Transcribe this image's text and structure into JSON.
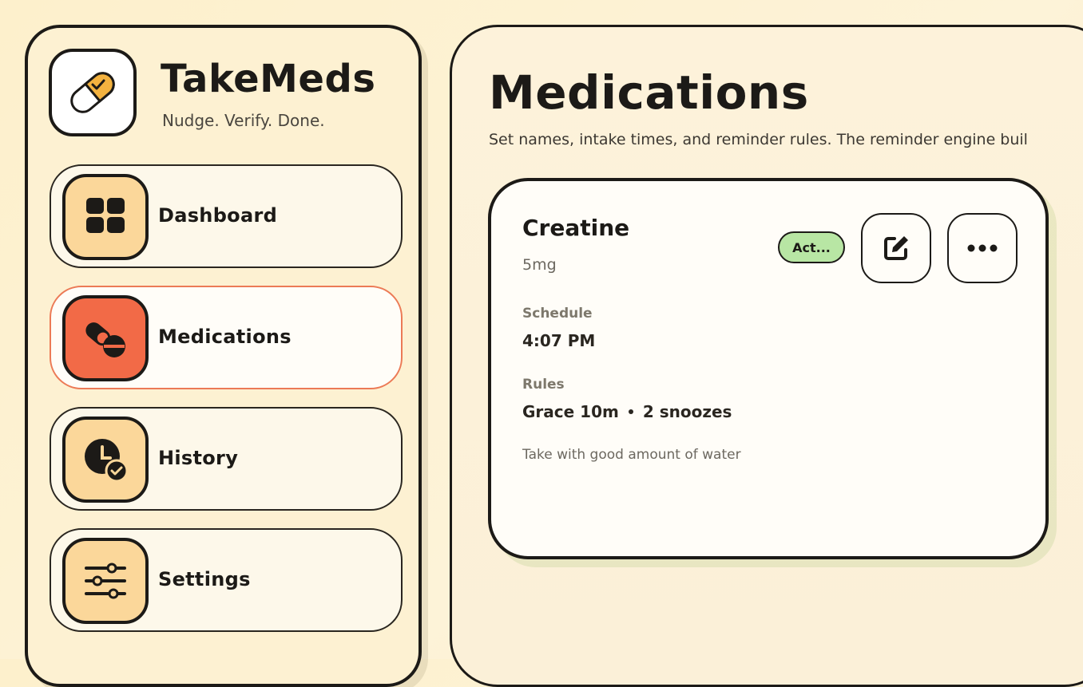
{
  "brand": {
    "name": "TakeMeds",
    "tagline": "Nudge. Verify. Done."
  },
  "sidebar": {
    "items": [
      {
        "label": "Dashboard",
        "icon": "grid-icon",
        "active": false
      },
      {
        "label": "Medications",
        "icon": "pills-icon",
        "active": true
      },
      {
        "label": "History",
        "icon": "clock-check-icon",
        "active": false
      },
      {
        "label": "Settings",
        "icon": "sliders-icon",
        "active": false
      }
    ]
  },
  "main": {
    "title": "Medications",
    "subtitle": "Set names, intake times, and reminder rules. The reminder engine buil"
  },
  "medication": {
    "name": "Creatine",
    "dose": "5mg",
    "status": "Act...",
    "schedule_label": "Schedule",
    "schedule_value": "4:07 PM",
    "rules_label": "Rules",
    "rule_grace": "Grace 10m",
    "rule_snoozes": "2 snoozes",
    "notes": "Take with good amount of water"
  },
  "colors": {
    "accent": "#f26a47",
    "icon_bg": "#fbd79a",
    "status_active": "#b8e6a4",
    "background": "#fdf0cc"
  }
}
